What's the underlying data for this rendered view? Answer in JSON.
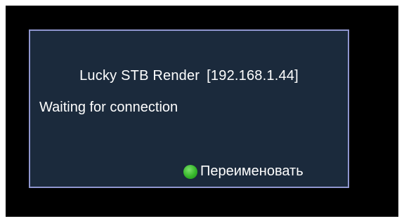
{
  "dialog": {
    "device_name": "Lucky STB Render",
    "ip_address": "[192.168.1.44]",
    "status": "Waiting for connection",
    "rename_action": {
      "label": "Переименовать",
      "key_icon": "green-button-icon",
      "key_color": "#35b52a"
    }
  },
  "colors": {
    "screen_background": "#000000",
    "dialog_background": "#1b2a3c",
    "dialog_border": "#8f96cf",
    "text": "#ffffff"
  }
}
